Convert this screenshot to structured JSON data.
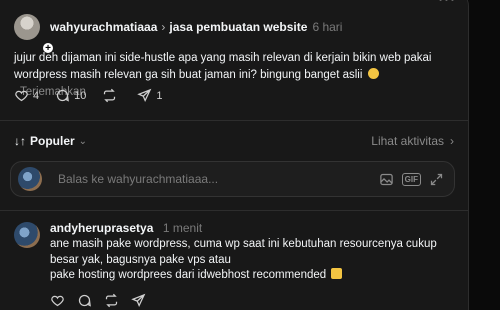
{
  "post": {
    "username": "wahyurachmatiaaa",
    "separator": "›",
    "topic": "jasa pembuatan website",
    "time": "6 hari",
    "text": "jujur deh dijaman ini side-hustle apa yang masih relevan di kerjain bikin web pakai wordpress masih relevan ga sih buat jaman ini? bingung banget aslii",
    "translate_label": "Terjemahkan",
    "likes": "4",
    "comments": "10",
    "shares": "1"
  },
  "sort": {
    "label": "Populer",
    "activity_label": "Lihat aktivitas",
    "arrow": "›"
  },
  "reply": {
    "placeholder": "Balas ke wahyurachmatiaaa..."
  },
  "comment": {
    "username": "andyheruprasetya",
    "time": "1 menit",
    "line1": "ane masih pake wordpress, cuma wp saat ini kebutuhan resourcenya cukup besar yak, bagusnya pake vps atau",
    "line2": "pake hosting wordprees dari idwebhost recommended"
  },
  "icons": {
    "more": "more-icon",
    "like": "heart-icon",
    "comment": "comment-icon",
    "repost": "repost-icon",
    "share": "share-icon",
    "sort": "sort-icon",
    "image": "image-icon",
    "gif": "gif-icon",
    "expand": "expand-icon"
  }
}
